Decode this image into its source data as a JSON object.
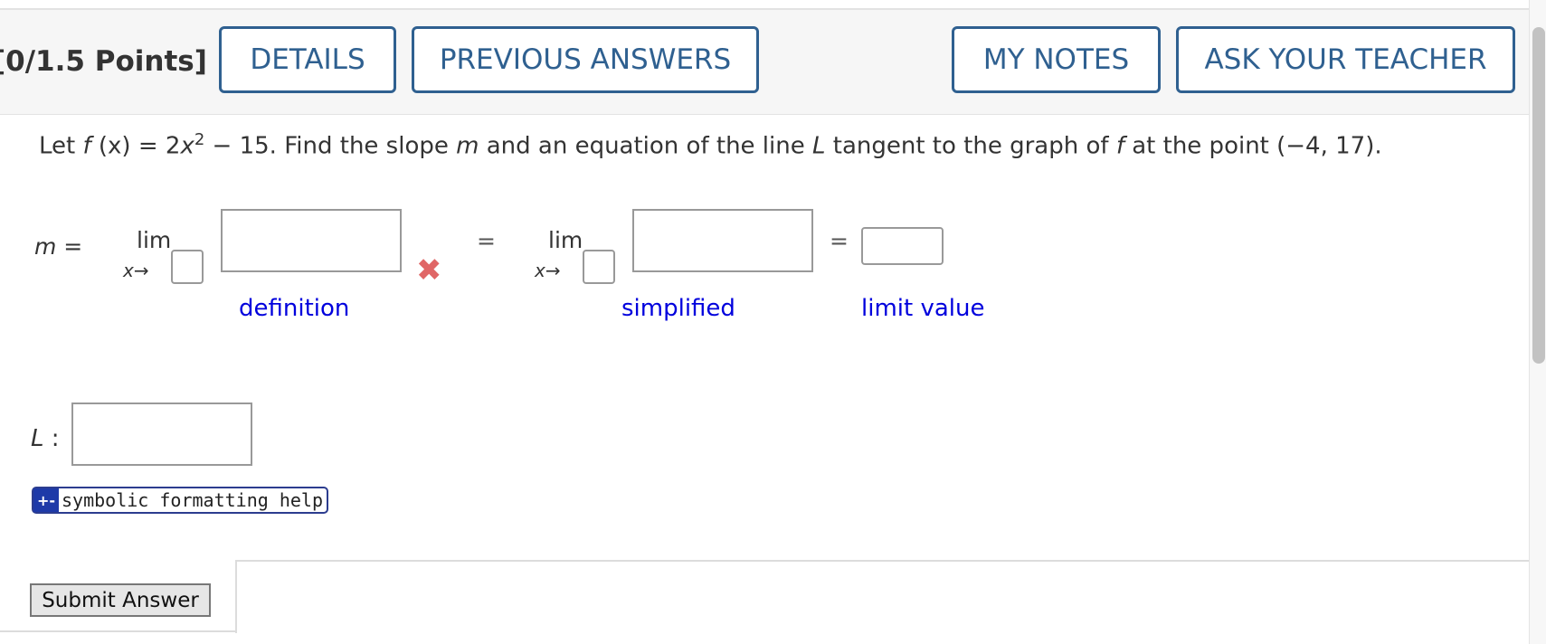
{
  "header": {
    "points": "[0/1.5 Points]",
    "buttons": {
      "details": "DETAILS",
      "previous_answers": "PREVIOUS ANSWERS",
      "my_notes": "MY NOTES",
      "ask_teacher": "ASK YOUR TEACHER"
    }
  },
  "question": {
    "let": "Let",
    "f": "f",
    "x_arg": " (x) ",
    "eq": "= 2",
    "x_var": "x",
    "exp": "2",
    "rest_1": " − 15. Find the slope ",
    "m": "m",
    "rest_2": " and an equation of the line ",
    "L": "L",
    "rest_3": " tangent to the graph of ",
    "f2": "f",
    "rest_4": " at the point (−4, 17)."
  },
  "answer": {
    "m_var": "m",
    "m_eq": " =",
    "lim": "lim",
    "x_var": "x",
    "arrow": "→",
    "equals": "=",
    "definition_label": "definition",
    "simplified_label": "simplified",
    "limit_value_label": "limit value",
    "L_var": "L",
    "L_colon": " :",
    "incorrect_mark": "✖"
  },
  "help": {
    "icon": "+-",
    "label": "symbolic formatting help"
  },
  "submit": {
    "label": "Submit Answer"
  },
  "colors": {
    "accent": "#2f6090",
    "label_blue": "#0000dd",
    "incorrect_red": "#e06666"
  }
}
